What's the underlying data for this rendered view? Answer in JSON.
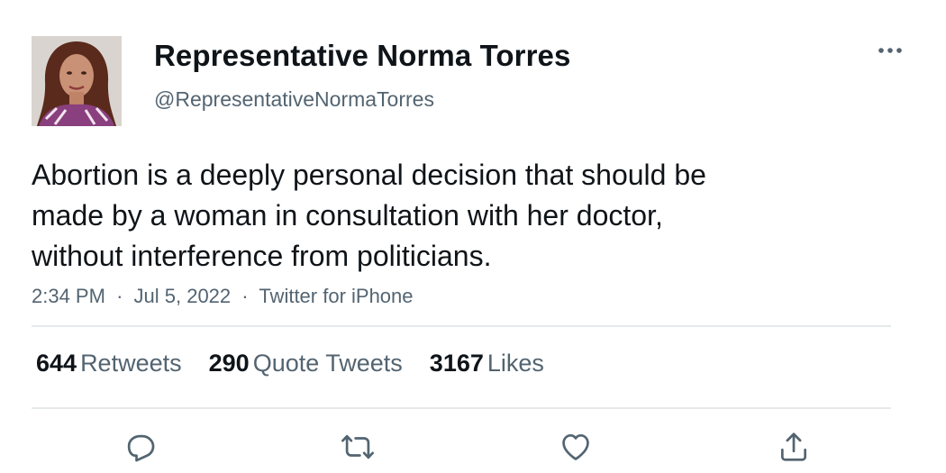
{
  "author": {
    "display_name": "Representative Norma Torres",
    "handle": "@RepresentativeNormaTorres",
    "avatar_icon": "profile-photo"
  },
  "tweet": {
    "text_lines": [
      "Abortion is a deeply personal decision that should be",
      "made by a woman in consultation with her doctor,",
      "without interference from politicians."
    ],
    "time": "2:34 PM",
    "date": "Jul 5, 2022",
    "source": "Twitter for iPhone",
    "separator": "·"
  },
  "stats": {
    "retweets": {
      "count": "644",
      "label": "Retweets"
    },
    "quote_tweets": {
      "count": "290",
      "label": "Quote Tweets"
    },
    "likes": {
      "count": "3167",
      "label": "Likes"
    }
  },
  "actions": {
    "reply_icon": "reply-icon",
    "retweet_icon": "retweet-icon",
    "like_icon": "heart-icon",
    "share_icon": "share-icon"
  },
  "colors": {
    "text": "#0f1419",
    "secondary": "#536471",
    "divider": "#e6e9eb"
  }
}
